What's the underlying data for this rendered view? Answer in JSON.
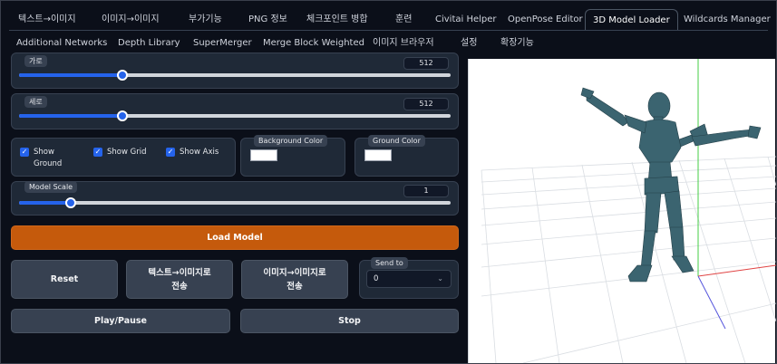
{
  "tabs_row1": [
    "텍스트→이미지",
    "이미지→이미지",
    "부가기능",
    "PNG 정보",
    "체크포인트 병합",
    "훈련",
    "Civitai Helper",
    "OpenPose Editor",
    "3D Model Loader",
    "Wildcards Manager"
  ],
  "tabs_row2": [
    "Additional Networks",
    "Depth Library",
    "SuperMerger",
    "Merge Block Weighted",
    "이미지 브라우저",
    "설정",
    "확장기능"
  ],
  "active_tab": "3D Model Loader",
  "width": {
    "label": "가로",
    "value": "512",
    "fraction": 0.24
  },
  "height": {
    "label": "세로",
    "value": "512",
    "fraction": 0.24
  },
  "checks": {
    "show_ground": {
      "label_line1": "Show",
      "label_line2": "Ground",
      "checked": true
    },
    "show_grid": {
      "label": "Show Grid",
      "checked": true
    },
    "show_axis": {
      "label": "Show Axis",
      "checked": true
    }
  },
  "background_color": {
    "label": "Background Color",
    "value": "#ffffff"
  },
  "ground_color": {
    "label": "Ground Color",
    "value": "#ffffff"
  },
  "model_scale": {
    "label": "Model Scale",
    "value": "1",
    "fraction": 0.12
  },
  "buttons": {
    "load_model": "Load Model",
    "reset": "Reset",
    "send_txt2img_line1": "텍스트→이미지로",
    "send_txt2img_line2": "전송",
    "send_img2img_line1": "이미지→이미지로",
    "send_img2img_line2": "전송",
    "play_pause": "Play/Pause",
    "stop": "Stop"
  },
  "send_to": {
    "label": "Send to",
    "value": "0"
  },
  "colors": {
    "accent": "#2563eb",
    "primary_button": "#c55a0c",
    "model": "#3b6470",
    "axis_x": "#e04444",
    "axis_y": "#44cc44",
    "axis_z": "#5555dd"
  }
}
